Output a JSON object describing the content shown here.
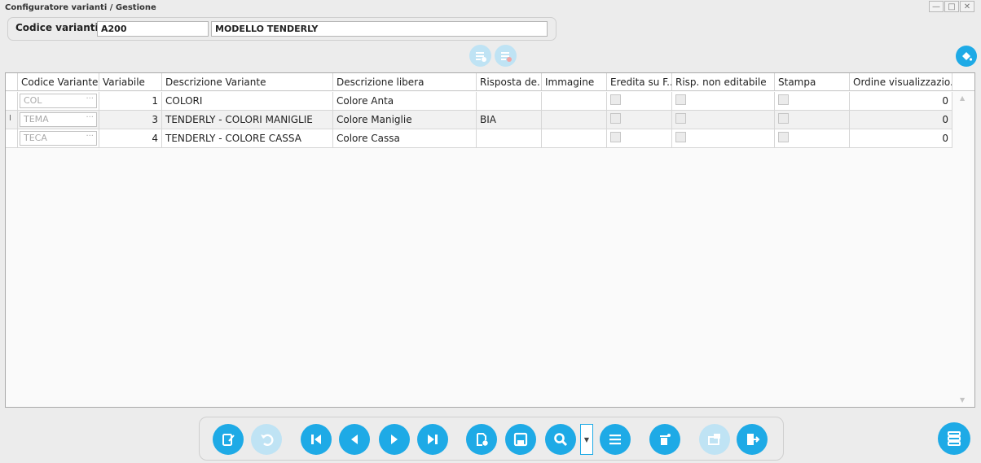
{
  "window": {
    "title": "Configuratore varianti / Gestione",
    "controls": [
      "—",
      "□",
      "✕"
    ]
  },
  "header": {
    "label": "Codice varianti :",
    "code_value": "A200",
    "description_value": "MODELLO TENDERLY"
  },
  "grid": {
    "columns": [
      "",
      "Codice Variante",
      "Variabile",
      "Descrizione Variante",
      "Descrizione libera",
      "Risposta de...",
      "Immagine",
      "Eredita su F...",
      "Risp. non editabile",
      "Stampa",
      "Ordine visualizzazio..."
    ],
    "rows": [
      {
        "indicator": "",
        "code": "COL",
        "variabile": "1",
        "descrizione": "COLORI",
        "libera": "Colore Anta",
        "risposta": "",
        "ordine": "0"
      },
      {
        "indicator": "I",
        "code": "TEMA",
        "variabile": "3",
        "descrizione": "TENDERLY - COLORI MANIGLIE",
        "libera": "Colore Maniglie",
        "risposta": "BIA",
        "ordine": "0"
      },
      {
        "indicator": "",
        "code": "TECA",
        "variabile": "4",
        "descrizione": "TENDERLY - COLORE CASSA",
        "libera": "Colore Cassa",
        "risposta": "",
        "ordine": "0"
      }
    ],
    "code_ellipsis": "···",
    "scroll_up": "▲",
    "scroll_down": "▼"
  },
  "toolbar_icons": [
    "edit-icon",
    "undo-icon",
    "first-record-icon",
    "previous-record-icon",
    "next-record-icon",
    "last-record-icon",
    "new-record-icon",
    "save-icon",
    "search-icon",
    "list-icon",
    "delete-icon",
    "copy-icon",
    "exit-icon"
  ],
  "colors": {
    "accent": "#1eaae6",
    "accent_disabled": "#bfe3f4"
  }
}
